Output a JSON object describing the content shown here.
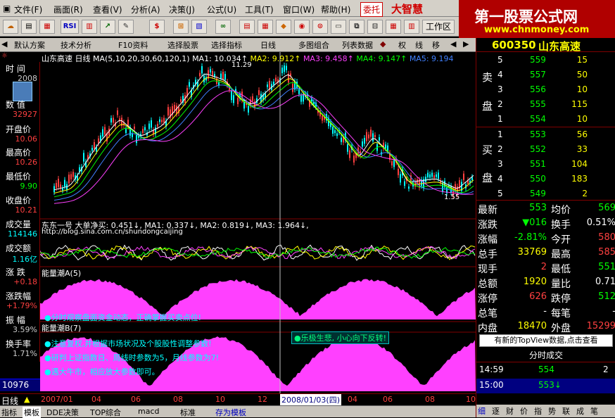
{
  "menu": [
    "文件(F)",
    "画面(R)",
    "查看(V)",
    "分析(A)",
    "决策(J)",
    "公式(U)",
    "工具(T)",
    "窗口(W)",
    "帮助(H)"
  ],
  "menu_right": {
    "trust": "委托",
    "brand": "大智慧"
  },
  "toolbar": {
    "rsi": "RSI",
    "workspace": "工作区"
  },
  "watermark": {
    "line1": "第一股票公式网",
    "line2": "www.chnmoney.com"
  },
  "tabs": [
    "默认方案",
    "技术分析",
    "F10资料",
    "选择股票",
    "选择指标",
    "日线",
    "多图组合",
    "列表数据",
    "权",
    "线",
    "移"
  ],
  "stock": {
    "code": "600350",
    "name": "山东高速"
  },
  "main_chart": {
    "title": "山东高速",
    "period": "日线",
    "ma_label": "MA(5,10,20,30,60,120,1)",
    "ma1": "MA1: 10.034↑",
    "ma2": "MA2: 9.912↑",
    "ma3": "MA3: 9.458↑",
    "ma4": "MA4: 9.147↑",
    "ma5": "MA5: 9.194",
    "high_mark": "11.29",
    "low_mark": "1.55"
  },
  "left_panel": {
    "time_label": "时 间",
    "time_val": "2008",
    "num_label": "数 值",
    "num_val": "32927",
    "open_label": "开盘价",
    "open_val": "10.06",
    "high_label": "最高价",
    "high_val": "10.26",
    "low_label": "最低价",
    "low_val": "9.90",
    "close_label": "收盘价",
    "close_val": "10.21",
    "vol_label": "成交量",
    "vol_val": "114146",
    "amt_label": "成交额",
    "amt_val": "1.16亿",
    "chg_label": "涨 跌",
    "chg_val": "+0.18",
    "pct_label": "涨跌幅",
    "pct_val": "+1.79%",
    "amp_label": "振 幅",
    "amp_val": "3.59%",
    "turn_label": "换手率",
    "turn_val": "1.71%",
    "bottom_val": "10976"
  },
  "indicator1": {
    "name": "东东一号",
    "title": "大单净买: 0.451↓, MA1: 0.337↓, MA2: 0.819↓, MA3: 1.964↓,",
    "url": "http://blog.sina.com.cn/shundongcaijing"
  },
  "indicator2": {
    "title": "能量潮A(5)",
    "note": "●分时观察盘面资金动态，正确掌握买卖点位!"
  },
  "indicator3": {
    "title": "能量潮B(7)",
    "note1": "●注意复权,并根据市场状况及个股股性调整参数!",
    "note2": "●研判上证指数日、周线时参数为5，月线参数为7!",
    "note3": "●遇大牛市，相应放大参数即可。",
    "popup": "●乐极生悲, 小心向下反转!"
  },
  "status": {
    "period": "日线",
    "dates": [
      "2007/01",
      "04",
      "06",
      "08",
      "10",
      "12"
    ],
    "cursor_date": "2008/01/03(四)",
    "dates_right": [
      "04",
      "06",
      "08",
      "10"
    ]
  },
  "bottom_tabs": [
    "指标",
    "模板",
    "DDE决策",
    "TOP综合",
    "macd",
    "标准",
    "存为模板"
  ],
  "order_book": {
    "sell_label": "卖",
    "sell_label2": "盘",
    "buy_label": "买",
    "buy_label2": "盘",
    "sells": [
      {
        "lvl": "5",
        "price": "559",
        "vol": "15"
      },
      {
        "lvl": "4",
        "price": "557",
        "vol": "50"
      },
      {
        "lvl": "3",
        "price": "556",
        "vol": "10"
      },
      {
        "lvl": "2",
        "price": "555",
        "vol": "115"
      },
      {
        "lvl": "1",
        "price": "554",
        "vol": "10"
      }
    ],
    "buys": [
      {
        "lvl": "1",
        "price": "553",
        "vol": "56"
      },
      {
        "lvl": "2",
        "price": "552",
        "vol": "33"
      },
      {
        "lvl": "3",
        "price": "551",
        "vol": "104"
      },
      {
        "lvl": "4",
        "price": "550",
        "vol": "183"
      },
      {
        "lvl": "5",
        "price": "549",
        "vol": "2"
      }
    ]
  },
  "quote": [
    {
      "l1": "最新",
      "v1": "553",
      "l2": "均价",
      "v2": "569"
    },
    {
      "l1": "涨跌",
      "v1": "▼016",
      "l2": "换手",
      "v2": "0.51%"
    },
    {
      "l1": "涨幅",
      "v1": "-2.81%",
      "l2": "今开",
      "v2": "580"
    },
    {
      "l1": "总手",
      "v1": "33769",
      "l2": "最高",
      "v2": "585"
    },
    {
      "l1": "现手",
      "v1": "2",
      "l2": "最低",
      "v2": "551"
    },
    {
      "l1": "总额",
      "v1": "1920",
      "l2": "量比",
      "v2": "0.71"
    },
    {
      "l1": "涨停",
      "v1": "626",
      "l2": "跌停",
      "v2": "512"
    },
    {
      "l1": "总笔",
      "v1": "-",
      "l2": "每笔",
      "v2": "-"
    },
    {
      "l1": "内盘",
      "v1": "18470",
      "l2": "外盘",
      "v2": "15299"
    }
  ],
  "topview": "有新的TopView数据,点击查看",
  "trades_title": "分时成交",
  "trades": [
    {
      "t": "14:59",
      "p": "554",
      "v": "2"
    },
    {
      "t": "15:00",
      "p": "553↓",
      "v": ""
    }
  ],
  "right_tabs": [
    "细",
    "逐",
    "财",
    "价",
    "指",
    "势",
    "联",
    "成",
    "笔"
  ],
  "colors": {
    "up": "#ff4040",
    "down": "#00ff00",
    "magenta": "#ff40ff",
    "yellow": "#ffff00"
  }
}
